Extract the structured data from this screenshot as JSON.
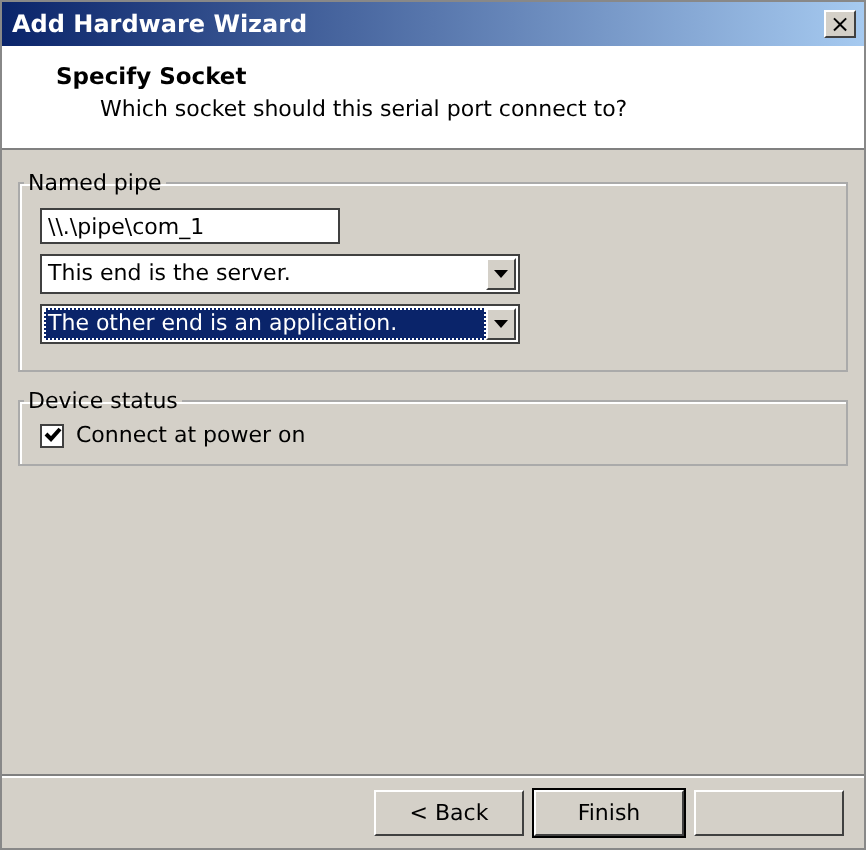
{
  "window": {
    "title": "Add Hardware Wizard",
    "close": "×"
  },
  "header": {
    "title": "Specify Socket",
    "subtitle": "Which socket should this serial port connect to?"
  },
  "named_pipe": {
    "label": "Named pipe",
    "path": "\\\\.\\pipe\\com_1",
    "dropdowns": [
      {
        "value": "This end is the server.",
        "focused": false
      },
      {
        "value": "The other end is an application.",
        "focused": true
      }
    ]
  },
  "device_status": {
    "label": "Device status",
    "checkbox": {
      "label": "Connect at power on",
      "checked": true
    }
  },
  "buttons": [
    {
      "label": "< Back",
      "kind": "back"
    },
    {
      "label": "Finish",
      "kind": "default"
    },
    {
      "kind": "blank"
    }
  ]
}
